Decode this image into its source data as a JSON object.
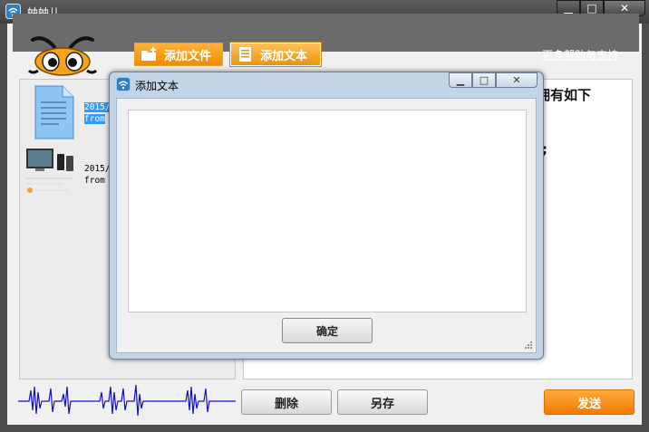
{
  "window": {
    "title": "蚰蚰儿",
    "min_label": "▁",
    "max_label": "□",
    "close_label": "✕"
  },
  "toolbar": {
    "add_file_label": "添加文件",
    "add_text_label": "添加文本",
    "help_link": "更多帮助与支持"
  },
  "list": {
    "items": [
      {
        "date": "2015/",
        "from": "from",
        "icon": "document-icon",
        "selected": true
      },
      {
        "date": "2015/",
        "from": "from",
        "icon": "devices-image",
        "selected": false
      }
    ]
  },
  "content": {
    "line1": "蚰蚰儿是一款网络化学技术，目的在于的工具，拥有如下",
    "line3": "捷;"
  },
  "bottom": {
    "delete_label": "删除",
    "save_as_label": "另存",
    "send_label": "发送"
  },
  "dialog": {
    "title": "添加文本",
    "textarea_value": "",
    "ok_label": "确定"
  },
  "colors": {
    "accent_orange": "#f08c00",
    "titlebar": "#4d4d4d",
    "dialog_frame": "#c3d4e7",
    "selection": "#3399ff"
  }
}
